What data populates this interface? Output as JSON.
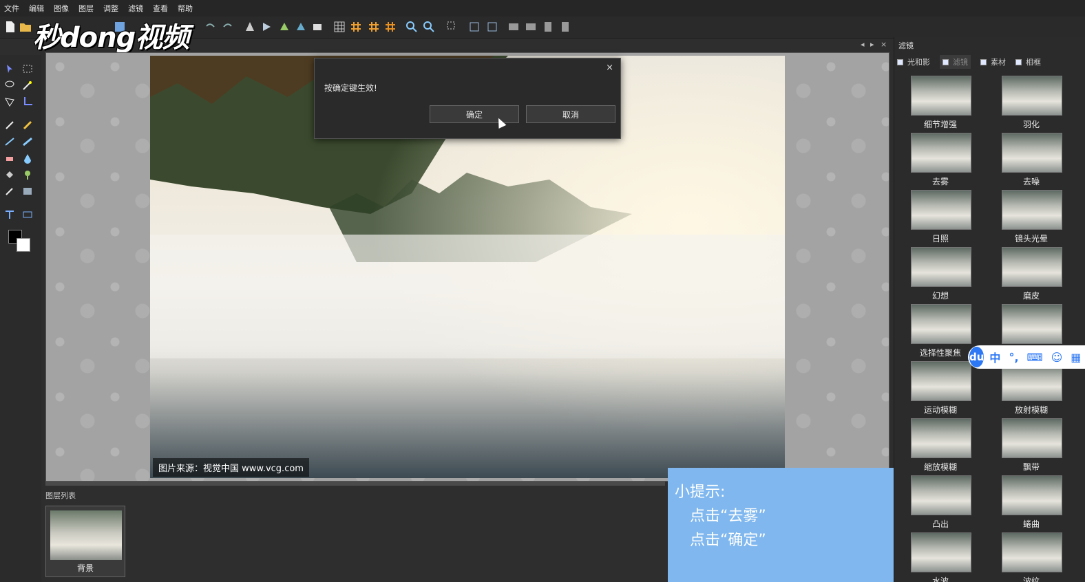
{
  "menu": [
    "文件",
    "编辑",
    "图像",
    "图层",
    "调整",
    "滤镜",
    "查看",
    "帮助"
  ],
  "logo": "秒dong视频",
  "dialog": {
    "message": "按确定键生效!",
    "ok": "确定",
    "cancel": "取消",
    "close": "×"
  },
  "credit": "图片来源：视觉中国 www.vcg.com",
  "layers": {
    "title": "图层列表",
    "items": [
      "背景"
    ]
  },
  "tip": {
    "line1": "小提示:",
    "line2": "点击“去雾”",
    "line3": "点击“确定”"
  },
  "panel": {
    "title": "滤镜",
    "tabs": [
      "光和影",
      "滤镜",
      "素材",
      "相框"
    ],
    "filters": [
      "细节增强",
      "羽化",
      "去雾",
      "去噪",
      "日照",
      "镜头光晕",
      "幻想",
      "磨皮",
      "选择性聚焦",
      "",
      "运动模糊",
      "放射模糊",
      "缩放模糊",
      "飘带",
      "凸出",
      "蜷曲",
      "水波",
      "波纹"
    ]
  },
  "ime": {
    "brand": "du",
    "lang": "中"
  },
  "window_controls": {
    "prev": "◂",
    "next": "▸",
    "close": "×"
  }
}
